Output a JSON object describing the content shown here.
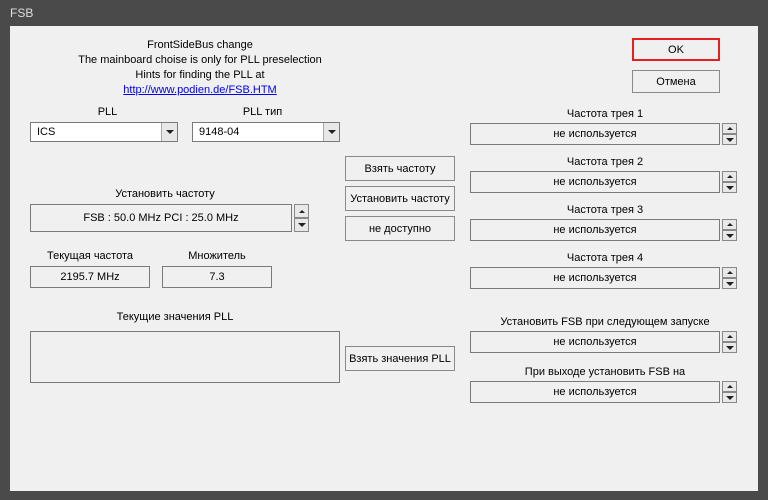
{
  "window": {
    "title": "FSB"
  },
  "header": {
    "line1": "FrontSideBus change",
    "line2": "The mainboard choise is only for PLL preselection",
    "line3": "Hints for finding the PLL at",
    "link": "http://www.podien.de/FSB.HTM"
  },
  "buttons": {
    "ok": "OK",
    "cancel": "Отмена",
    "get_freq": "Взять частоту",
    "set_freq": "Установить частоту",
    "na": "не доступно",
    "get_pll": "Взять значения PLL"
  },
  "labels": {
    "pll": "PLL",
    "pll_type": "PLL тип",
    "set_freq": "Установить частоту",
    "cur_freq": "Текущая частота",
    "multiplier": "Множитель",
    "cur_pll": "Текущие значения PLL",
    "tray1": "Частота трея 1",
    "tray2": "Частота трея 2",
    "tray3": "Частота трея 3",
    "tray4": "Частота трея 4",
    "fsb_next": "Установить FSB при следующем запуске",
    "fsb_exit": "При выходе установить FSB на"
  },
  "values": {
    "pll": "ICS",
    "pll_type": "9148-04",
    "set_freq": "FSB :  50.0 MHz  PCI :  25.0 MHz",
    "cur_freq": "2195.7 MHz",
    "multiplier": "7.3",
    "unused": "не используется"
  }
}
